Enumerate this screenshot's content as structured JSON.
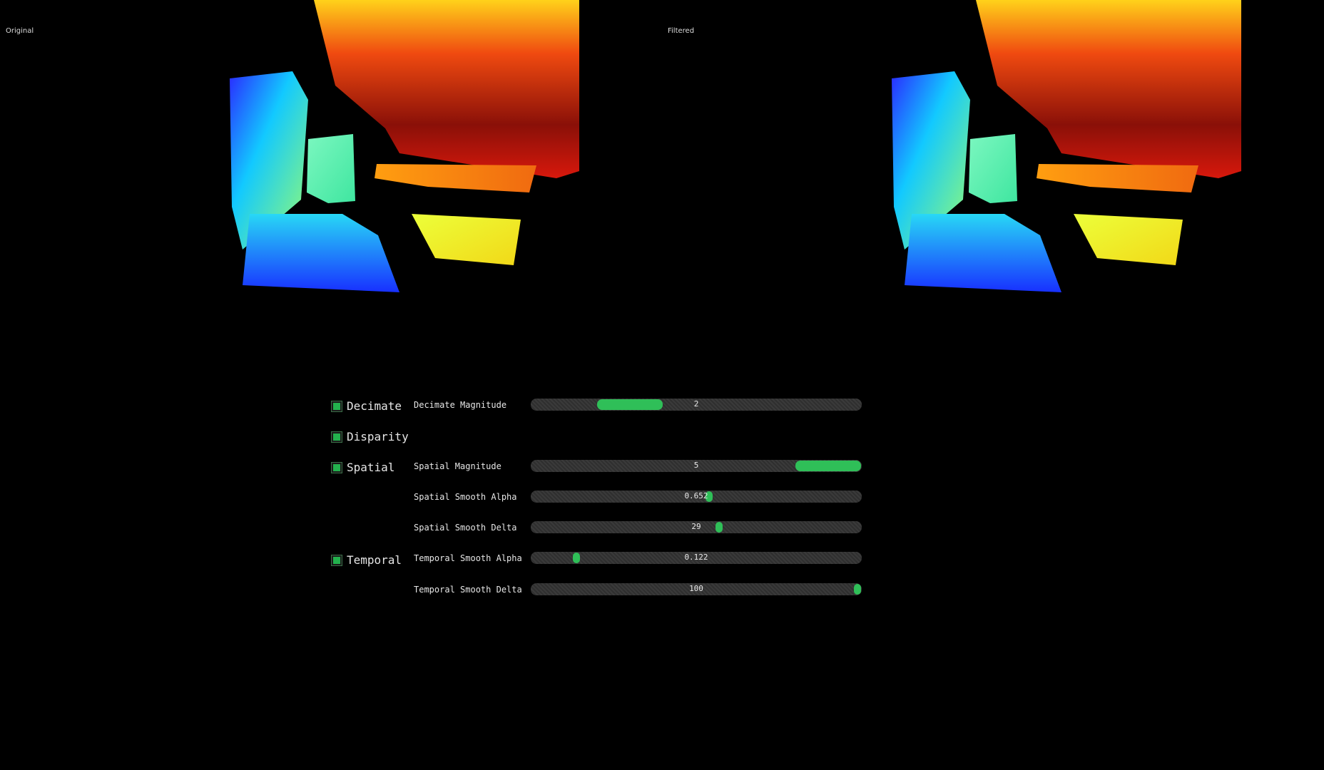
{
  "panes": {
    "left_label": "Original",
    "right_label": "Filtered"
  },
  "controls": {
    "checkboxes": [
      {
        "label": "Decimate",
        "checked": true
      },
      {
        "label": "Disparity",
        "checked": true
      },
      {
        "label": "Spatial",
        "checked": true
      },
      {
        "label": "Temporal",
        "checked": true
      }
    ],
    "sliders": [
      {
        "label": "Decimate Magnitude",
        "value": "2",
        "level": 0.25
      },
      {
        "label": "Spatial Magnitude",
        "value": "5",
        "level": 1.0
      },
      {
        "label": "Spatial Smooth Alpha",
        "value": "0.652",
        "level": 0.54
      },
      {
        "label": "Spatial Smooth Delta",
        "value": "29",
        "level": 0.57
      },
      {
        "label": "Temporal Smooth Alpha",
        "value": "0.122",
        "level": 0.13
      },
      {
        "label": "Temporal Smooth Delta",
        "value": "100",
        "level": 1.0
      }
    ]
  },
  "colors": {
    "accent": "#2fbf58",
    "track": "#333333",
    "background": "#000000"
  }
}
